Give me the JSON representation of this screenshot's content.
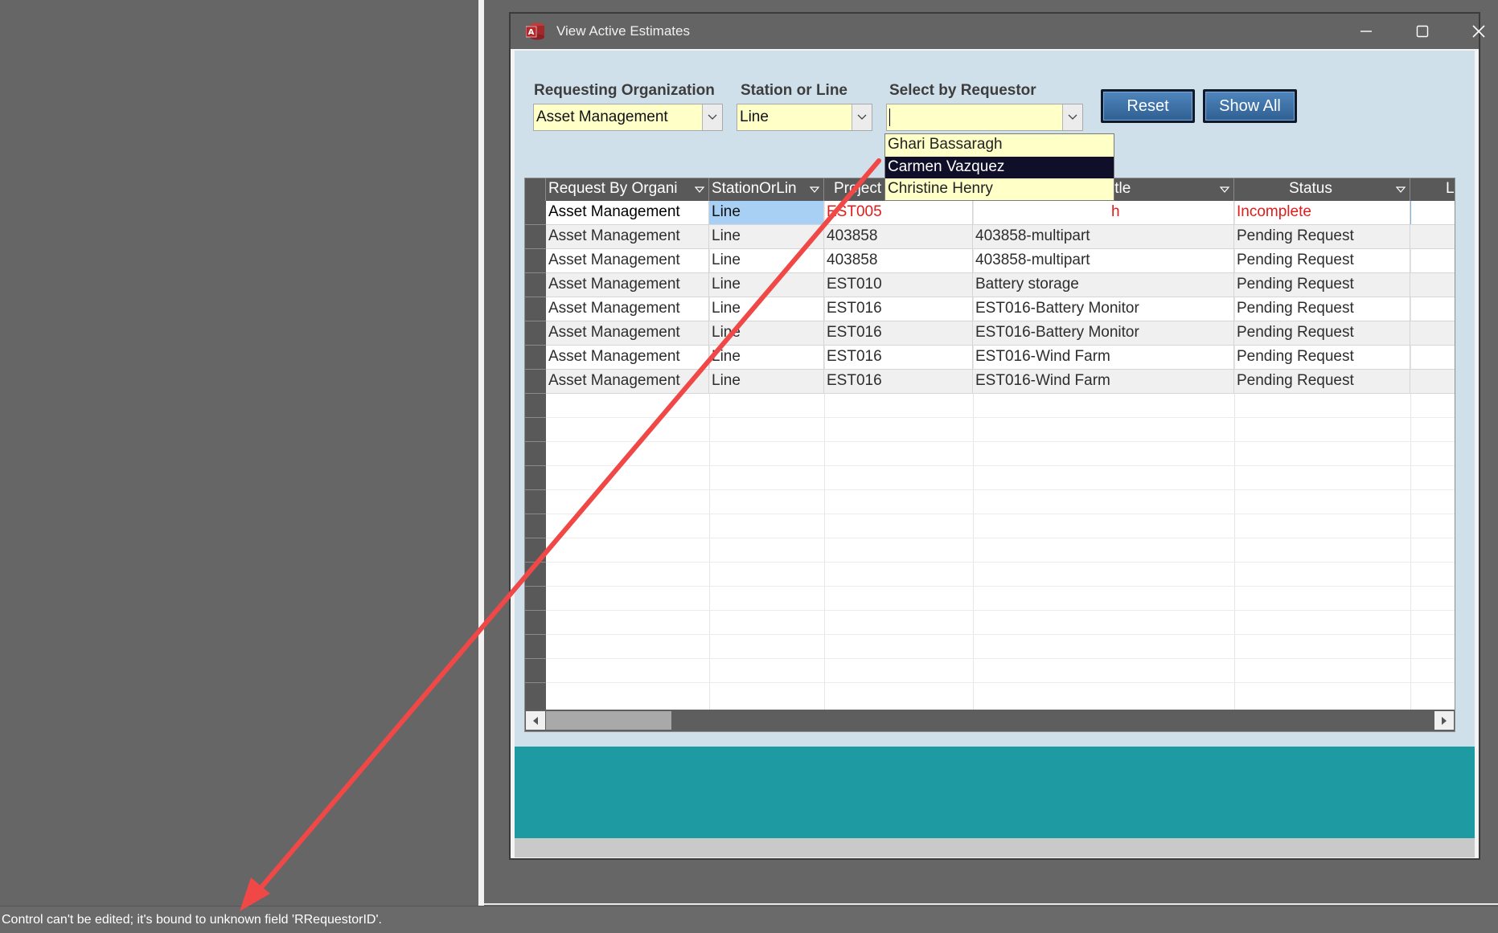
{
  "window": {
    "title": "View Active Estimates"
  },
  "filters": {
    "org_label": "Requesting Organization",
    "org_value": "Asset Management",
    "station_label": "Station or Line",
    "station_value": "Line",
    "requestor_label": "Select by Requestor",
    "requestor_value": ""
  },
  "buttons": {
    "reset": "Reset",
    "show_all": "Show All"
  },
  "requestor_options": [
    {
      "label": "Ghari Bassaragh",
      "highlighted": false
    },
    {
      "label": "Carmen Vazquez",
      "highlighted": true
    },
    {
      "label": "Christine Henry",
      "highlighted": false
    }
  ],
  "grid": {
    "columns": [
      "Request By Organi",
      "StationOrLin",
      "Project",
      "itle",
      "Status",
      "L"
    ],
    "rows": [
      [
        "Asset Management",
        "Line",
        "EST005",
        "h",
        "Incomplete",
        ""
      ],
      [
        "Asset Management",
        "Line",
        "403858",
        "403858-multipart",
        "Pending Request",
        ""
      ],
      [
        "Asset Management",
        "Line",
        "403858",
        "403858-multipart",
        "Pending Request",
        ""
      ],
      [
        "Asset Management",
        "Line",
        "EST010",
        "Battery storage",
        "Pending Request",
        ""
      ],
      [
        "Asset Management",
        "Line",
        "EST016",
        "EST016-Battery Monitor",
        "Pending Request",
        ""
      ],
      [
        "Asset Management",
        "Line",
        "EST016",
        "EST016-Battery Monitor",
        "Pending Request",
        ""
      ],
      [
        "Asset Management",
        "Line",
        "EST016",
        "EST016-Wind Farm",
        "Pending Request",
        ""
      ],
      [
        "Asset Management",
        "Line",
        "EST016",
        "EST016-Wind Farm",
        "Pending Request",
        ""
      ]
    ]
  },
  "status_bar": {
    "message": "Control can't be edited; it's bound to unknown field 'RRequestorID'."
  },
  "colors": {
    "accent_red": "#e21b1b",
    "teal": "#1e9ba2",
    "annotation_arrow": "#f04747"
  }
}
